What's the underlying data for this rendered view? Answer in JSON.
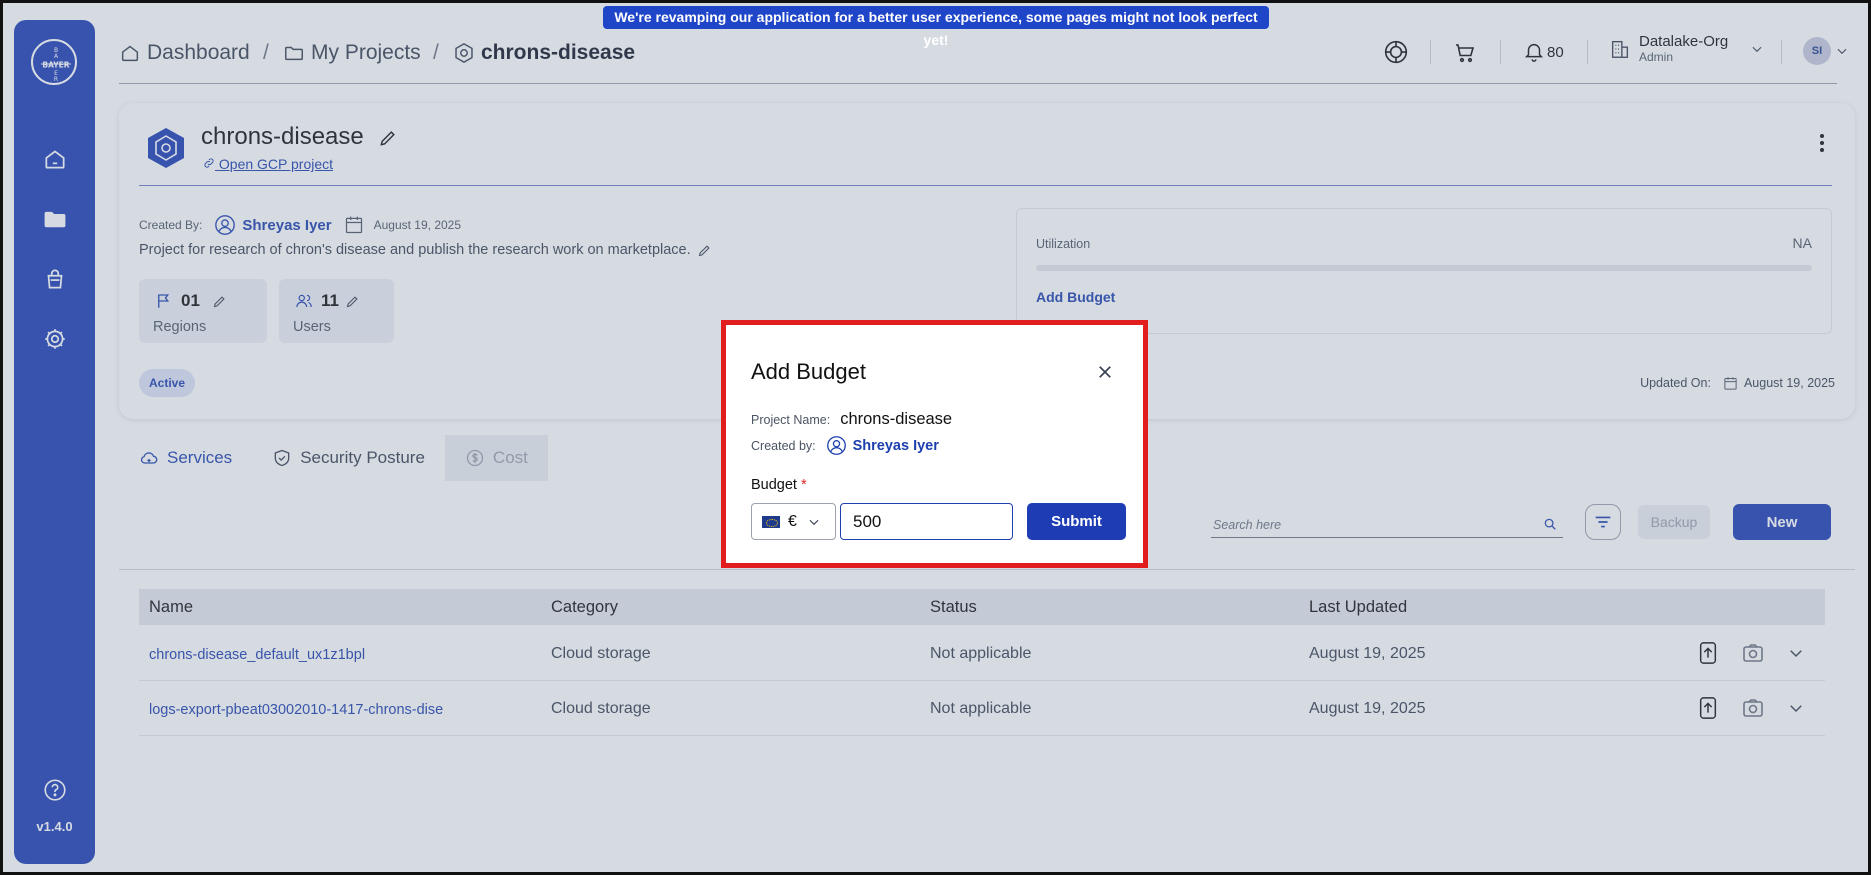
{
  "banner": "We're revamping our application for a better user experience, some pages might not look perfect yet!",
  "sidebar": {
    "logo_text": "BAYER",
    "version": "v1.4.0"
  },
  "breadcrumb": {
    "dashboard": "Dashboard",
    "projects": "My Projects",
    "current": "chrons-disease",
    "separator": "/"
  },
  "header": {
    "notifications": "80",
    "org_name": "Datalake-Org",
    "org_role": "Admin",
    "avatar": "SI"
  },
  "project": {
    "title": "chrons-disease",
    "gcp_link": "Open GCP project",
    "created_by_label": "Created By:",
    "creator": "Shreyas Iyer",
    "created_date": "August 19, 2025",
    "description": "Project for research of chron's disease and publish the research work on marketplace.",
    "regions_count": "01",
    "regions_label": "Regions",
    "users_count": "11",
    "users_label": "Users",
    "status": "Active",
    "utilization_label": "Utilization",
    "utilization_value": "NA",
    "add_budget": "Add Budget",
    "updated_label": "Updated On:",
    "updated_date": "August 19, 2025"
  },
  "tabs": [
    {
      "label": "Services"
    },
    {
      "label": "Security Posture"
    },
    {
      "label": "Cost"
    }
  ],
  "services": {
    "search_placeholder": "Search here",
    "backup_label": "Backup",
    "new_label": "New",
    "columns": [
      "Name",
      "Category",
      "Status",
      "Last Updated"
    ],
    "rows": [
      {
        "name": "chrons-disease_default_ux1z1bpl",
        "category": "Cloud storage",
        "status": "Not applicable",
        "updated": "August 19, 2025"
      },
      {
        "name": "logs-export-pbeat03002010-1417-chrons-dise",
        "category": "Cloud storage",
        "status": "Not applicable",
        "updated": "August 19, 2025"
      }
    ]
  },
  "modal": {
    "title": "Add Budget",
    "project_name_label": "Project Name:",
    "project_name": "chrons-disease",
    "created_by_label": "Created by:",
    "creator": "Shreyas Iyer",
    "budget_label": "Budget",
    "required_mark": "*",
    "currency": "€",
    "budget_value": "500",
    "submit_label": "Submit"
  },
  "colors": {
    "primary": "#1e3db5",
    "link": "#1e40af",
    "highlight": "#e11d1d"
  }
}
